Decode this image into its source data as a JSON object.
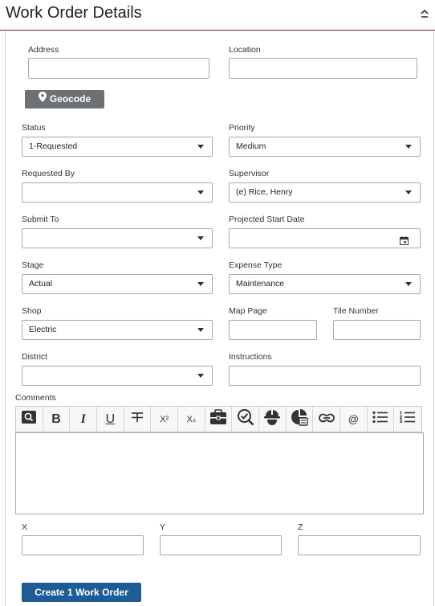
{
  "header": {
    "title": "Work Order Details"
  },
  "fields": {
    "address": {
      "label": "Address",
      "value": ""
    },
    "location": {
      "label": "Location",
      "value": ""
    },
    "geocode_label": "Geocode",
    "status": {
      "label": "Status",
      "value": "1-Requested"
    },
    "priority": {
      "label": "Priority",
      "value": "Medium"
    },
    "requested_by": {
      "label": "Requested By",
      "value": ""
    },
    "supervisor": {
      "label": "Supervisor",
      "value": "(e) Rice, Henry"
    },
    "submit_to": {
      "label": "Submit To",
      "value": ""
    },
    "projected_start_date": {
      "label": "Projected Start Date",
      "value": ""
    },
    "stage": {
      "label": "Stage",
      "value": "Actual"
    },
    "expense_type": {
      "label": "Expense Type",
      "value": "Maintenance"
    },
    "shop": {
      "label": "Shop",
      "value": "Electric"
    },
    "map_page": {
      "label": "Map Page",
      "value": ""
    },
    "tile_number": {
      "label": "Tile Number",
      "value": ""
    },
    "district": {
      "label": "District",
      "value": ""
    },
    "instructions": {
      "label": "Instructions",
      "value": ""
    },
    "comments": {
      "label": "Comments",
      "value": ""
    },
    "x": {
      "label": "X",
      "value": ""
    },
    "y": {
      "label": "Y",
      "value": ""
    },
    "z": {
      "label": "Z",
      "value": ""
    }
  },
  "toolbar": {
    "bold": "B",
    "italic": "I",
    "underline": "U",
    "superscript": "X²",
    "subscript": "Xₛ",
    "mention": "@"
  },
  "actions": {
    "create_label": "Create 1 Work Order"
  },
  "colors": {
    "header_rule": "#8b1a2b",
    "geocode_button": "#6d7075",
    "create_button": "#1d5c96"
  }
}
